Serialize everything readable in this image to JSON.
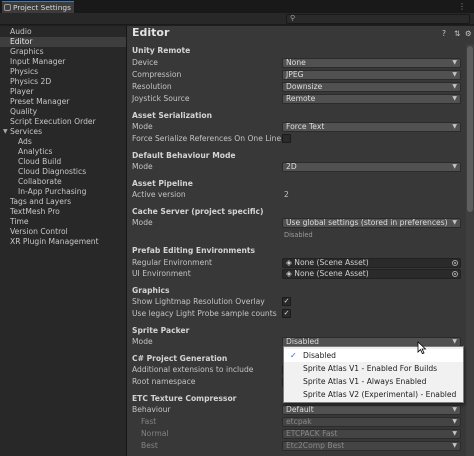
{
  "window": {
    "tab_title": "Project Settings",
    "tab_icon": "settings-window-icon"
  },
  "sidebar": {
    "items": [
      {
        "label": "Audio"
      },
      {
        "label": "Editor",
        "selected": true
      },
      {
        "label": "Graphics"
      },
      {
        "label": "Input Manager"
      },
      {
        "label": "Physics"
      },
      {
        "label": "Physics 2D"
      },
      {
        "label": "Player"
      },
      {
        "label": "Preset Manager"
      },
      {
        "label": "Quality"
      },
      {
        "label": "Script Execution Order"
      },
      {
        "label": "Services",
        "expanded": true
      },
      {
        "label": "Ads",
        "child": true
      },
      {
        "label": "Analytics",
        "child": true
      },
      {
        "label": "Cloud Build",
        "child": true
      },
      {
        "label": "Cloud Diagnostics",
        "child": true
      },
      {
        "label": "Collaborate",
        "child": true
      },
      {
        "label": "In-App Purchasing",
        "child": true
      },
      {
        "label": "Tags and Layers"
      },
      {
        "label": "TextMesh Pro"
      },
      {
        "label": "Time"
      },
      {
        "label": "Version Control"
      },
      {
        "label": "XR Plugin Management"
      }
    ]
  },
  "main": {
    "title": "Editor",
    "unity_remote": {
      "header": "Unity Remote",
      "device_label": "Device",
      "device_value": "None",
      "compression_label": "Compression",
      "compression_value": "JPEG",
      "resolution_label": "Resolution",
      "resolution_value": "Downsize",
      "joystick_label": "Joystick Source",
      "joystick_value": "Remote"
    },
    "asset_serialization": {
      "header": "Asset Serialization",
      "mode_label": "Mode",
      "mode_value": "Force Text",
      "force_label": "Force Serialize References On One Line"
    },
    "default_behaviour": {
      "header": "Default Behaviour Mode",
      "mode_label": "Mode",
      "mode_value": "2D"
    },
    "asset_pipeline": {
      "header": "Asset Pipeline",
      "version_label": "Active version",
      "version_value": "2"
    },
    "cache_server": {
      "header": "Cache Server (project specific)",
      "mode_label": "Mode",
      "mode_value": "Use global settings (stored in preferences)",
      "status": "Disabled"
    },
    "prefab_env": {
      "header": "Prefab Editing Environments",
      "regular_label": "Regular Environment",
      "regular_value": "None (Scene Asset)",
      "ui_label": "UI Environment",
      "ui_value": "None (Scene Asset)"
    },
    "graphics": {
      "header": "Graphics",
      "lightmap_label": "Show Lightmap Resolution Overlay",
      "lightmap_checked": true,
      "probe_label": "Use legacy Light Probe sample counts",
      "probe_checked": true,
      "check_glyph": "✓"
    },
    "sprite_packer": {
      "header": "Sprite Packer",
      "mode_label": "Mode",
      "mode_value": "Disabled"
    },
    "csharp": {
      "header": "C# Project Generation",
      "extensions_label": "Additional extensions to include",
      "namespace_label": "Root namespace"
    },
    "etc": {
      "header": "ETC Texture Compressor",
      "behaviour_label": "Behaviour",
      "behaviour_value": "Default",
      "fast_label": "Fast",
      "fast_value": "etcpak",
      "normal_label": "Normal",
      "normal_value": "ETCPACK Fast",
      "best_label": "Best",
      "best_value": "Etc2Comp Best"
    }
  },
  "popup": {
    "options": [
      {
        "label": "Disabled",
        "selected": true
      },
      {
        "label": "Sprite Atlas V1 - Enabled For Builds"
      },
      {
        "label": "Sprite Atlas V1 - Always Enabled"
      },
      {
        "label": "Sprite Atlas V2 (Experimental) - Enabled"
      }
    ]
  },
  "colors": {
    "accent": "#3a79bb",
    "panel": "#383838",
    "sidebar": "#282828",
    "popup_bg": "#f1f1f1",
    "tick": "#1f6fd1"
  },
  "icons": [
    "search-icon",
    "help-icon",
    "preset-icon",
    "gear-icon",
    "kebab-menu-icon",
    "object-picker-icon",
    "dropdown-arrow-icon",
    "checkmark-icon",
    "mouse-pointer-icon"
  ]
}
